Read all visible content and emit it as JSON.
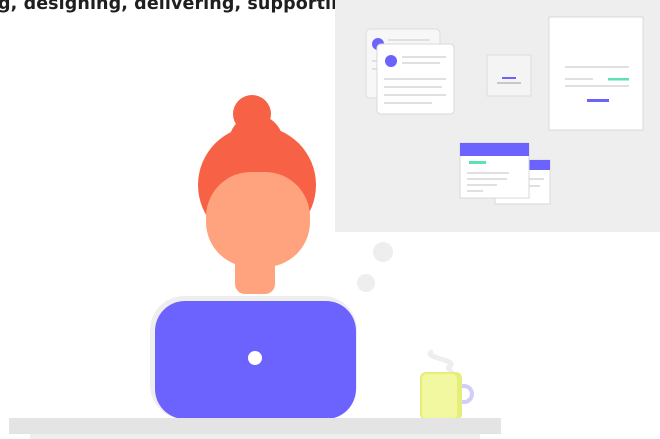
{
  "headline": "g, designing, delivering, supporting and managing.",
  "colors": {
    "accent_purple": "#6c63ff",
    "hair": "#f76146",
    "skin": "#ffa37f",
    "board": "#eeeeee",
    "mug": "#f2f8a0",
    "desk": "#e4e4e4",
    "accent_green": "#5ce1b0"
  },
  "icons": [
    "laptop-logo-dot",
    "steam-icon",
    "thought-bubble"
  ]
}
